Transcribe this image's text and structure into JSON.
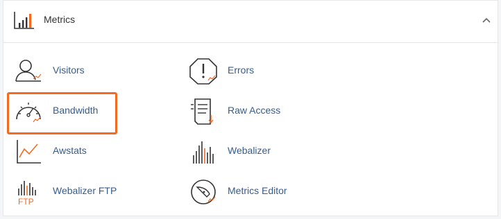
{
  "section": {
    "title": "Metrics",
    "icon": "bar-chart-icon",
    "collapse_icon": "chevron-up-icon"
  },
  "items": [
    {
      "label": "Visitors",
      "icon": "visitors-icon"
    },
    {
      "label": "Errors",
      "icon": "errors-icon"
    },
    {
      "label": "Bandwidth",
      "icon": "bandwidth-gauge-icon"
    },
    {
      "label": "Raw Access",
      "icon": "raw-access-document-icon"
    },
    {
      "label": "Awstats",
      "icon": "awstats-line-chart-icon"
    },
    {
      "label": "Webalizer",
      "icon": "webalizer-bars-icon"
    },
    {
      "label": "Webalizer FTP",
      "icon": "webalizer-ftp-icon",
      "badge": "FTP"
    },
    {
      "label": "Metrics Editor",
      "icon": "metrics-editor-icon"
    }
  ],
  "colors": {
    "accent": "#f26b21",
    "link": "#365c8d",
    "icon_stroke": "#333333"
  }
}
